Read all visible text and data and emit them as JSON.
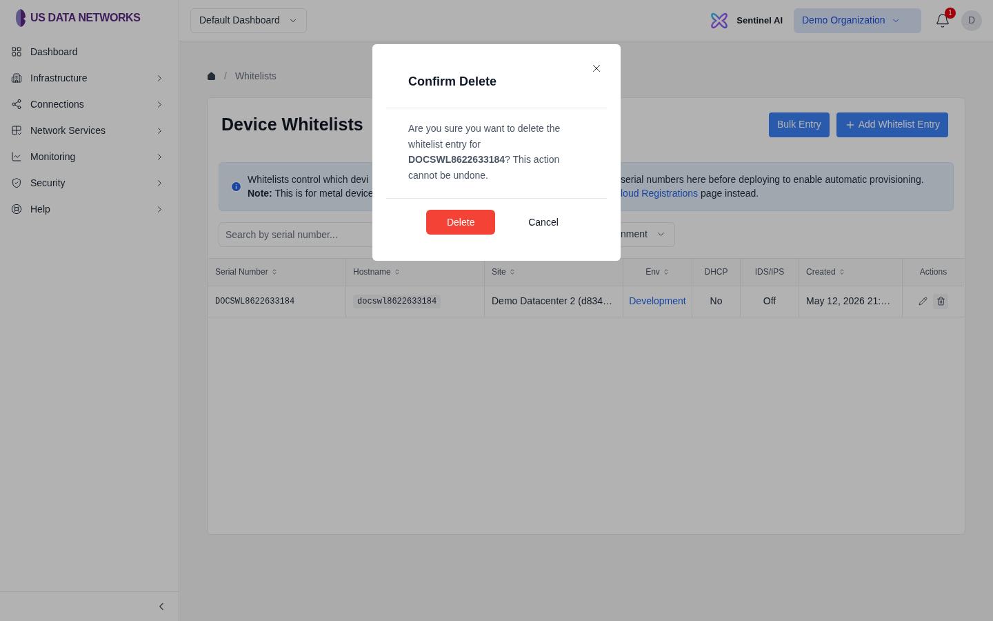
{
  "brand": {
    "name": "US DATA NETWORKS"
  },
  "sidebar": {
    "items": [
      {
        "label": "Dashboard",
        "expandable": false
      },
      {
        "label": "Infrastructure",
        "expandable": true
      },
      {
        "label": "Connections",
        "expandable": true
      },
      {
        "label": "Network Services",
        "expandable": true
      },
      {
        "label": "Monitoring",
        "expandable": true
      },
      {
        "label": "Security",
        "expandable": true
      },
      {
        "label": "Help",
        "expandable": true
      }
    ]
  },
  "header": {
    "dashboard_select": "Default Dashboard",
    "assistant": "Sentinel AI",
    "organization": "Demo Organization",
    "notification_count": "1",
    "avatar": "D"
  },
  "breadcrumb": {
    "separator": "/",
    "items": [
      "Whitelists"
    ]
  },
  "page": {
    "title": "Device Whitelists",
    "buttons": [
      {
        "label": "Bulk Entry",
        "kind": "plain"
      },
      {
        "label": "Add Whitelist Entry",
        "kind": "add"
      }
    ]
  },
  "info": {
    "line_1_left": "Whitelists control which devi",
    "line_1_right": "serial numbers here before deploying to enable automatic provisioning.",
    "line_2_left": "**Note:** This is for metal device",
    "line_2_link": "loud Registrations",
    "line_2_rest": "page instead."
  },
  "filters": {
    "search_placeholder": "Search by serial number...",
    "environment": "nment"
  },
  "table": {
    "columns": [
      {
        "label": "Serial Number",
        "sortable": true
      },
      {
        "label": "Hostname",
        "sortable": true
      },
      {
        "label": "Site",
        "sortable": true
      },
      {
        "label": "Env",
        "sortable": true
      },
      {
        "label": "DHCP",
        "sortable": false
      },
      {
        "label": "IDS/IPS",
        "sortable": false
      },
      {
        "label": "Created",
        "sortable": true
      },
      {
        "label": "Actions",
        "sortable": false
      }
    ],
    "rows": [
      {
        "serial": "DOCSWL8622633184",
        "hostname": "docswl8622633184",
        "site": "Demo Datacenter 2 (d834…",
        "env": "Development",
        "dhcp": "No",
        "ids_ips": "Off",
        "created": "May 12, 2026 21:…"
      }
    ]
  },
  "dialog": {
    "title": "Confirm Delete",
    "message": "Are you sure you want to delete the whitelist entry for **DOCSWL8622633184**? This action cannot be undone.",
    "buttons": [
      {
        "label": "Delete",
        "kind": "danger"
      },
      {
        "label": "Cancel",
        "kind": "plain"
      }
    ]
  }
}
